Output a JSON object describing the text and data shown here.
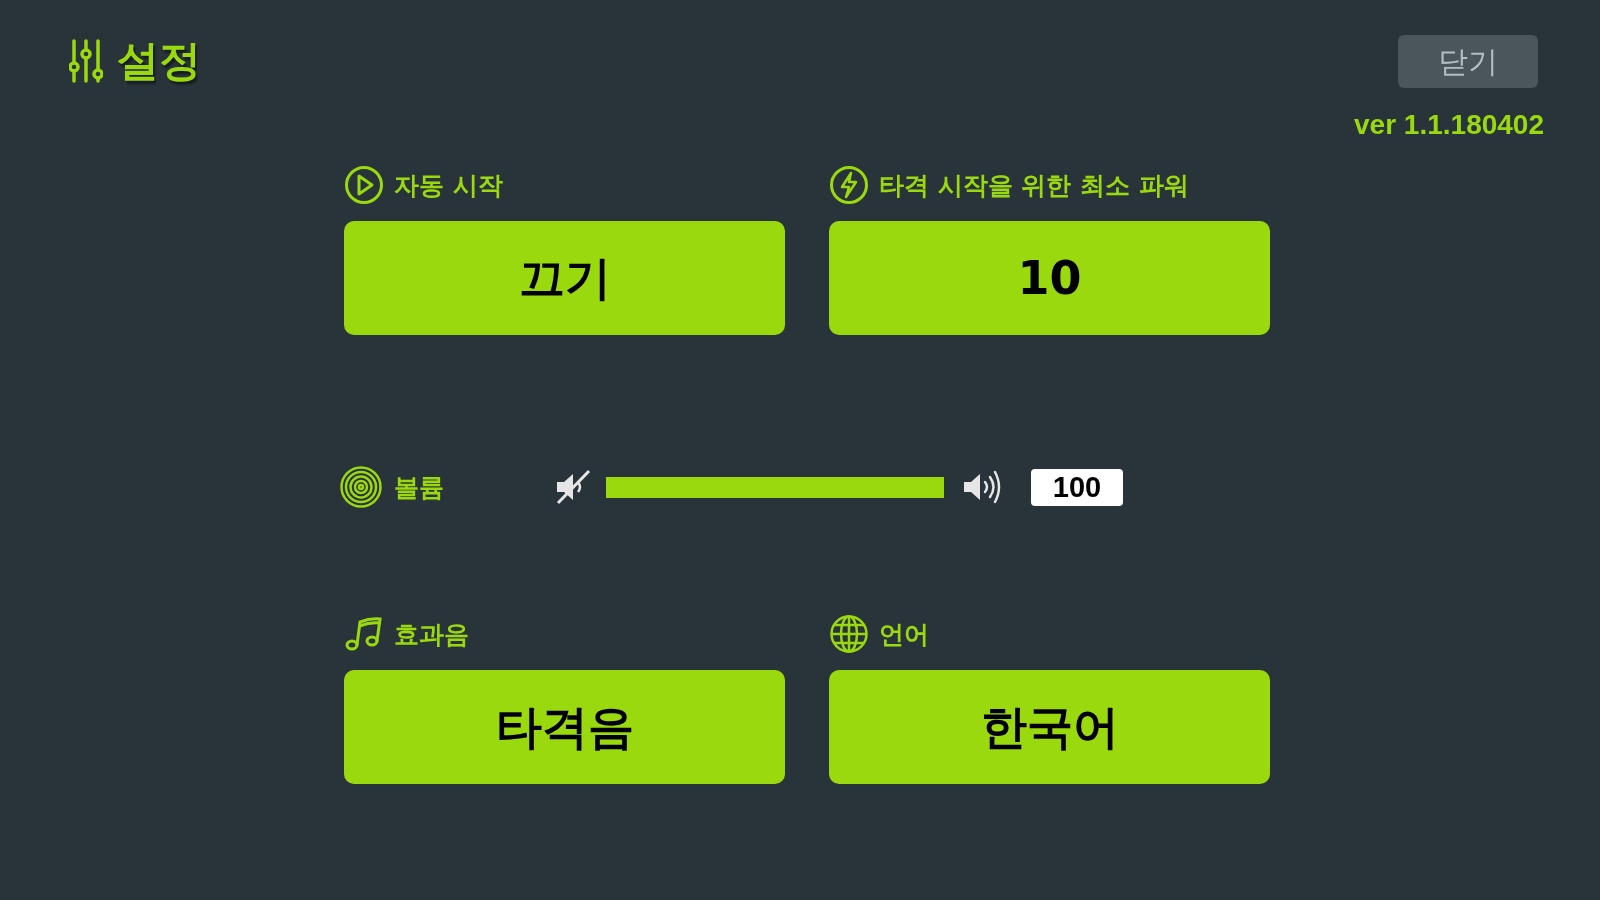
{
  "header": {
    "title": "설정",
    "close_button": "닫기",
    "version": "ver 1.1.180402"
  },
  "top_settings": [
    {
      "label": "자동 시작",
      "value": "끄기"
    },
    {
      "label": "타격 시작을 위한 최소 파워",
      "value": "10"
    }
  ],
  "volume": {
    "label": "볼륨",
    "level": 1,
    "reading": "100"
  },
  "bottom_settings": [
    {
      "label": "효과음",
      "value": "타격음"
    },
    {
      "label": "언어",
      "value": "한국어"
    }
  ]
}
